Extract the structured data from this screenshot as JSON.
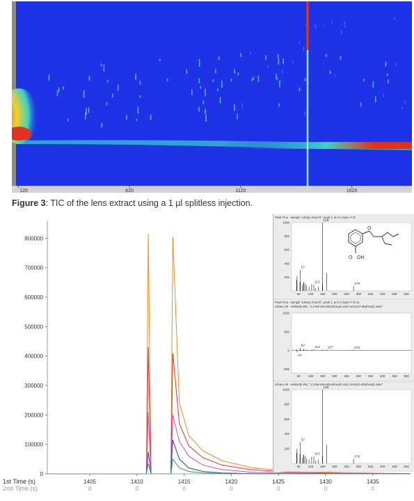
{
  "heatmap_chart": {
    "type": "heatmap",
    "x_ticks": [
      {
        "label": "120",
        "value": 120
      },
      {
        "label": "620",
        "value": 620
      },
      {
        "label": "1120",
        "value": 1120
      },
      {
        "label": "1620",
        "value": 1620
      }
    ],
    "xlim": [
      110,
      1890
    ],
    "marker_line_x": 1420,
    "colors": {
      "background": "#1f33e6",
      "hot": "#e0321e",
      "warm": "#f0d228",
      "mid": "#3cd2c8"
    }
  },
  "caption": {
    "label": "Figure 3",
    "text": ": TIC of the lens extract using a 1 µl splitless injection."
  },
  "chart_data": {
    "type": "line",
    "xlabel": "1st Time (s)",
    "xlabel2": "2nd Time (s)",
    "x_ticks": [
      1405,
      1410,
      1415,
      1420,
      1425,
      1430,
      1435
    ],
    "x_ticks2": [
      "0",
      "0",
      "0",
      "0",
      "0",
      "0",
      "0"
    ],
    "xlim": [
      1400.5,
      1439
    ],
    "ylim": [
      0,
      860000
    ],
    "y_ticks": [
      0,
      100000,
      200000,
      300000,
      400000,
      500000,
      600000,
      700000,
      800000
    ],
    "peaks": [
      1411.2,
      1413.8
    ],
    "series": [
      {
        "color": "#f08c1e",
        "x": [
          1400.5,
          1411.0,
          1411.2,
          1411.5,
          1413.6,
          1413.8,
          1414.5,
          1415.5,
          1417,
          1419,
          1422,
          1426,
          1432,
          1439
        ],
        "y": [
          0,
          0,
          815000,
          0,
          0,
          805000,
          240000,
          130000,
          78000,
          45000,
          22000,
          10000,
          4000,
          1000
        ]
      },
      {
        "color": "#d83232",
        "x": [
          1400.5,
          1411.0,
          1411.2,
          1411.5,
          1413.6,
          1413.8,
          1414.5,
          1415.5,
          1417,
          1419,
          1422,
          1426,
          1432,
          1439
        ],
        "y": [
          0,
          0,
          430000,
          0,
          0,
          410000,
          170000,
          95000,
          55000,
          30000,
          15000,
          6000,
          2000,
          500
        ]
      },
      {
        "color": "#c850c8",
        "x": [
          1400.5,
          1411.0,
          1411.2,
          1411.5,
          1413.6,
          1413.8,
          1414.5,
          1415.5,
          1417,
          1419,
          1422,
          1426,
          1432,
          1439
        ],
        "y": [
          0,
          0,
          210000,
          0,
          0,
          200000,
          110000,
          60000,
          30000,
          15000,
          6000,
          2500,
          1000,
          200
        ]
      },
      {
        "color": "#283cb4",
        "x": [
          1400.5,
          1411.0,
          1411.2,
          1411.5,
          1413.6,
          1413.8,
          1414.5,
          1415.5,
          1417,
          1419,
          1422,
          1426,
          1432,
          1439
        ],
        "y": [
          0,
          0,
          75000,
          0,
          0,
          115000,
          50000,
          20000,
          8000,
          3000,
          1000,
          500,
          200,
          0
        ]
      },
      {
        "color": "#32a046",
        "x": [
          1400.5,
          1411.0,
          1411.2,
          1411.5,
          1413.6,
          1413.8,
          1414.5,
          1415.5,
          1417,
          1419,
          1422,
          1426,
          1432,
          1439
        ],
        "y": [
          0,
          0,
          35000,
          0,
          0,
          50000,
          20000,
          8000,
          3000,
          1000,
          500,
          200,
          0,
          0
        ]
      }
    ]
  },
  "spectra": [
    {
      "header": "Peak True - sample \"Library Search\", peak 1, at 0 s (Spec # 0)",
      "y_ticks": [
        "1000",
        "800",
        "600",
        "400",
        "200"
      ],
      "x_ticks": [
        "50",
        "100",
        "150",
        "200",
        "250",
        "300",
        "350",
        "400",
        "450",
        "500"
      ],
      "labels": [
        {
          "mz": 57,
          "rel": 310,
          "text": "57"
        },
        {
          "mz": 113,
          "rel": 95,
          "text": "113"
        },
        {
          "mz": 149,
          "rel": 1000,
          "text": "149"
        },
        {
          "mz": 279,
          "rel": 70,
          "text": "279"
        }
      ],
      "lines": [
        [
          41,
          160
        ],
        [
          43,
          220
        ],
        [
          55,
          130
        ],
        [
          57,
          310
        ],
        [
          65,
          90
        ],
        [
          70,
          120
        ],
        [
          71,
          130
        ],
        [
          76,
          110
        ],
        [
          83,
          80
        ],
        [
          93,
          60
        ],
        [
          104,
          100
        ],
        [
          113,
          95
        ],
        [
          121,
          40
        ],
        [
          132,
          60
        ],
        [
          149,
          1000
        ],
        [
          150,
          110
        ],
        [
          167,
          260
        ],
        [
          279,
          70
        ]
      ]
    },
    {
      "header": "Peak True - sample \"Library Search\", peak 1, at 0 s (Spec # 0) vs. Library Hit - similarity 951, \"1,2-Benzenedicarboxylic acid, mono(2-ethylhexyl) ester\"",
      "y_ticks": [
        "1000",
        "500",
        "0",
        "-500"
      ],
      "x_ticks": [
        "50",
        "100",
        "150",
        "200",
        "250",
        "300",
        "350",
        "400",
        "450",
        "500"
      ],
      "labels": [
        {
          "mz": 57,
          "rel": 70,
          "text": "57"
        },
        {
          "mz": 113,
          "rel": 30,
          "text": "113"
        },
        {
          "mz": 167,
          "rel": 20,
          "text": "167"
        },
        {
          "mz": 279,
          "rel": 15,
          "text": "279"
        },
        {
          "mz": 43,
          "rel": -45,
          "text": "43"
        }
      ],
      "lines": [
        [
          41,
          30
        ],
        [
          43,
          -45
        ],
        [
          55,
          25
        ],
        [
          57,
          70
        ],
        [
          70,
          30
        ],
        [
          71,
          40
        ],
        [
          83,
          20
        ],
        [
          104,
          20
        ],
        [
          113,
          30
        ],
        [
          149,
          20
        ],
        [
          150,
          10
        ],
        [
          167,
          20
        ],
        [
          279,
          15
        ]
      ]
    },
    {
      "header": "Library Hit - similarity 951, \"1,2-Benzenedicarboxylic acid, mono(2-ethylhexyl) ester\"",
      "y_ticks": [
        "1000",
        "800",
        "600",
        "400",
        "200"
      ],
      "x_ticks": [
        "50",
        "100",
        "150",
        "200",
        "250",
        "300",
        "350",
        "400",
        "450",
        "500"
      ],
      "labels": [
        {
          "mz": 57,
          "rel": 290,
          "text": "57"
        },
        {
          "mz": 113,
          "rel": 100,
          "text": "113"
        },
        {
          "mz": 149,
          "rel": 1000,
          "text": "149"
        },
        {
          "mz": 279,
          "rel": 60,
          "text": "279"
        }
      ],
      "lines": [
        [
          41,
          140
        ],
        [
          43,
          200
        ],
        [
          55,
          120
        ],
        [
          57,
          290
        ],
        [
          65,
          80
        ],
        [
          70,
          110
        ],
        [
          71,
          120
        ],
        [
          76,
          100
        ],
        [
          83,
          70
        ],
        [
          93,
          50
        ],
        [
          104,
          90
        ],
        [
          113,
          100
        ],
        [
          121,
          40
        ],
        [
          132,
          50
        ],
        [
          149,
          1000
        ],
        [
          150,
          100
        ],
        [
          167,
          250
        ],
        [
          279,
          60
        ]
      ]
    }
  ],
  "structure": {
    "label_o1": "O",
    "label_o2": "O",
    "label_oh": "OH"
  }
}
